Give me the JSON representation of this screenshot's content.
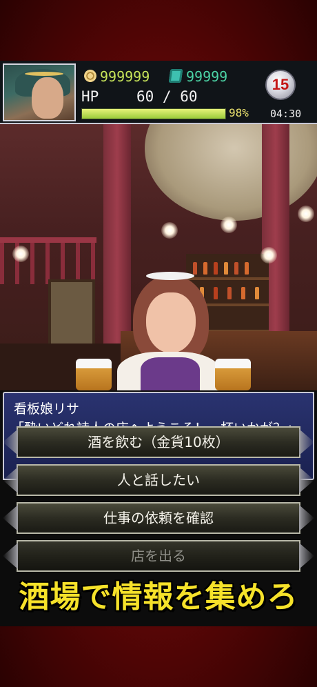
{
  "status": {
    "coins": "999999",
    "gems": "99999",
    "hp_label": "HP",
    "hp_value": "60 / 60",
    "hp_fraction": 1.0,
    "hp_percent": "98%",
    "day": "15",
    "time": "04:30",
    "colors": {
      "coins": "#c7e45a",
      "gems": "#4cd4a6",
      "hp_bar": "#b8dc48",
      "day": "#c41616"
    }
  },
  "icons": {
    "coin": "coin-icon",
    "gem": "gem-icon"
  },
  "dialog": {
    "speaker": "看板娘リサ",
    "line": "「酔いどれ詩人の店へようこそ！一杯いかが？」"
  },
  "menu": [
    {
      "label": "酒を飲む（金貨10枚）",
      "enabled": true
    },
    {
      "label": "人と話したい",
      "enabled": true
    },
    {
      "label": "仕事の依頼を確認",
      "enabled": true
    },
    {
      "label": "店を出る",
      "enabled": false
    }
  ],
  "slogan": "酒場で情報を集めろ"
}
